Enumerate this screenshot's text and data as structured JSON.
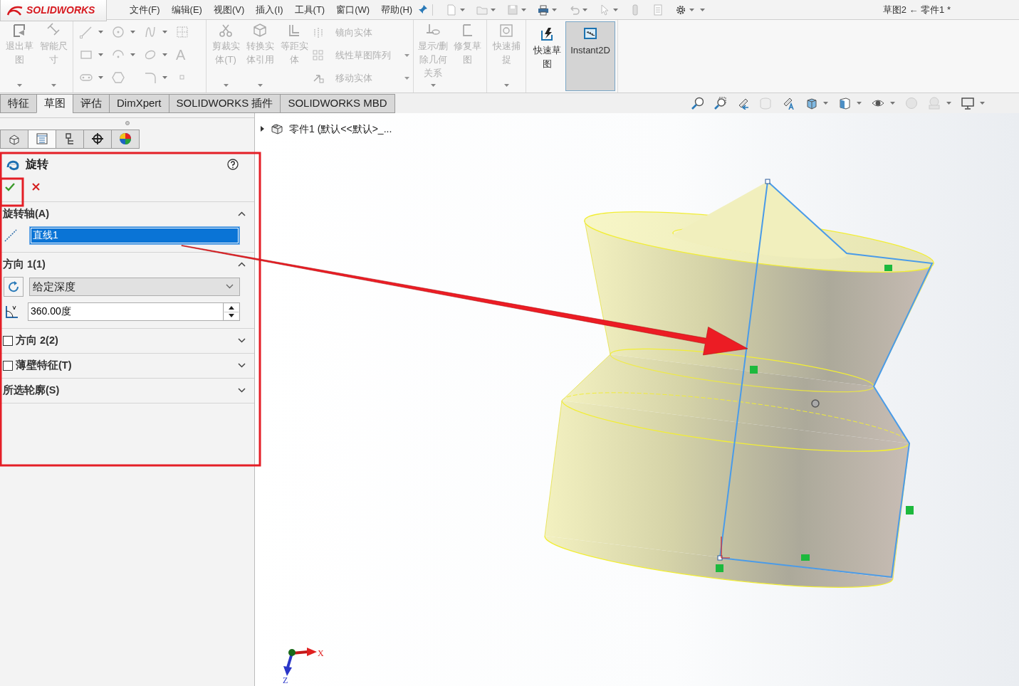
{
  "app": {
    "logo": "SOLIDWORKS"
  },
  "menu": [
    {
      "label": "文件(F)"
    },
    {
      "label": "编辑(E)"
    },
    {
      "label": "视图(V)"
    },
    {
      "label": "插入(I)"
    },
    {
      "label": "工具(T)"
    },
    {
      "label": "窗口(W)"
    },
    {
      "label": "帮助(H)"
    }
  ],
  "document_title": "草图2 ← 零件1 *",
  "ribbon": {
    "groups": [
      {
        "kind": "buttons",
        "items": [
          {
            "kind": "large",
            "label": "退出草图",
            "disabled": true,
            "dropdown": true
          },
          {
            "kind": "large",
            "label": "智能尺寸",
            "disabled": true,
            "dropdown": true
          }
        ]
      },
      {
        "kind": "sketch_tools",
        "text_glyph": "A",
        "disabled": true
      },
      {
        "kind": "buttons",
        "items": [
          {
            "kind": "large",
            "label": "剪裁实体(T)",
            "disabled": true,
            "dropdown": true
          },
          {
            "kind": "large",
            "label": "转换实体引用",
            "disabled": true,
            "dropdown": true
          },
          {
            "kind": "large",
            "label": "等距实体",
            "disabled": true,
            "dropdown": false
          },
          {
            "kind": "small",
            "label": "镜向实体",
            "disabled": true,
            "dropdown": false
          },
          {
            "kind": "small",
            "label": "线性草图阵列",
            "disabled": true,
            "dropdown": true
          },
          {
            "kind": "small",
            "label": "移动实体",
            "disabled": true,
            "dropdown": true
          }
        ]
      },
      {
        "kind": "buttons",
        "items": [
          {
            "kind": "large",
            "label": "显示/删除几何关系",
            "disabled": true,
            "dropdown": true
          },
          {
            "kind": "large",
            "label": "修复草图",
            "disabled": true,
            "dropdown": false
          }
        ]
      },
      {
        "kind": "buttons",
        "items": [
          {
            "kind": "large",
            "label": "快速捕捉",
            "disabled": true,
            "dropdown": true
          }
        ]
      },
      {
        "kind": "buttons",
        "items": [
          {
            "kind": "toggle",
            "label": "快速草图",
            "disabled": false,
            "on": false
          },
          {
            "kind": "toggle",
            "label": "Instant2D",
            "disabled": false,
            "on": true
          }
        ]
      }
    ]
  },
  "tabs": [
    {
      "label": "特征",
      "selected": false
    },
    {
      "label": "草图",
      "selected": true
    },
    {
      "label": "评估",
      "selected": false
    },
    {
      "label": "DimXpert",
      "selected": false
    },
    {
      "label": "SOLIDWORKS 插件",
      "selected": false
    },
    {
      "label": "SOLIDWORKS MBD",
      "selected": false
    }
  ],
  "panel_tabs": [
    {
      "kind": "feature_tree",
      "selected": false
    },
    {
      "kind": "property",
      "selected": true
    },
    {
      "kind": "configuration",
      "selected": false
    },
    {
      "kind": "dimxpert",
      "selected": false
    },
    {
      "kind": "appearance",
      "selected": false
    }
  ],
  "property_manager": {
    "title": "旋转",
    "sections": [
      {
        "kind": "axis",
        "title": "旋转轴(A)",
        "expanded": true,
        "field": {
          "value": "直线1",
          "selected": true
        }
      },
      {
        "kind": "direction",
        "title": "方向 1(1)",
        "expanded": true,
        "end_condition": "给定深度",
        "angle": "360.00度"
      },
      {
        "kind": "option",
        "title": "方向 2(2)",
        "expanded": false,
        "checked": false
      },
      {
        "kind": "option",
        "title": "薄壁特征(T)",
        "expanded": false,
        "checked": false
      },
      {
        "kind": "plain",
        "title": "所选轮廓(S)",
        "expanded": false
      }
    ]
  },
  "viewport": {
    "tree_item": {
      "label": "零件1 (默认<<默认>_...",
      "expanded": false
    },
    "axes": [
      "X",
      "Z"
    ]
  }
}
